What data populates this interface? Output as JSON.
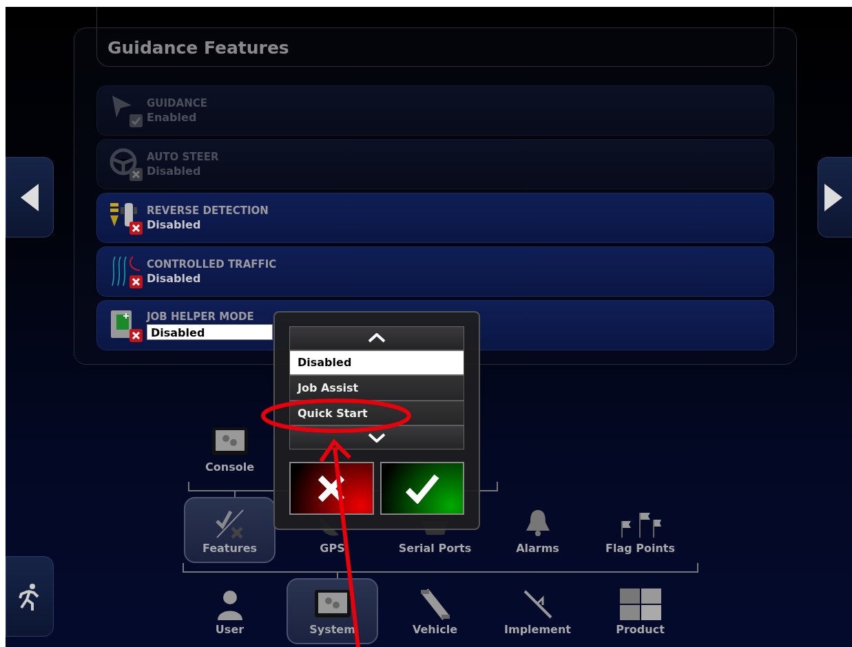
{
  "panel": {
    "title": "Guidance Features"
  },
  "features": [
    {
      "kind": "text",
      "title": "GUIDANCE",
      "value": "Enabled",
      "disabled": true,
      "on": true
    },
    {
      "kind": "text",
      "title": "AUTO STEER",
      "value": "Disabled",
      "disabled": true,
      "on": false
    },
    {
      "kind": "text",
      "title": "REVERSE DETECTION",
      "value": "Disabled",
      "disabled": false,
      "on": false
    },
    {
      "kind": "text",
      "title": "CONTROLLED TRAFFIC",
      "value": "Disabled",
      "disabled": false,
      "on": false
    },
    {
      "kind": "dropdown",
      "title": "JOB HELPER MODE",
      "value": "Disabled",
      "disabled": false,
      "on": false
    }
  ],
  "dropdown": {
    "options": [
      {
        "label": "Disabled",
        "selected": true
      },
      {
        "label": "Job Assist",
        "selected": false
      },
      {
        "label": "Quick Start",
        "selected": false
      }
    ]
  },
  "menu": [
    {
      "items": [
        {
          "label": "Console",
          "selected": false
        }
      ]
    },
    {
      "items": [
        {
          "label": "Features",
          "selected": true
        },
        {
          "label": "GPS",
          "selected": false
        },
        {
          "label": "Serial Ports",
          "selected": false
        },
        {
          "label": "Alarms",
          "selected": false
        },
        {
          "label": "Flag Points",
          "selected": false
        }
      ]
    },
    {
      "items": [
        {
          "label": "User",
          "selected": false
        },
        {
          "label": "System",
          "selected": true
        },
        {
          "label": "Vehicle",
          "selected": false
        },
        {
          "label": "Implement",
          "selected": false
        },
        {
          "label": "Product",
          "selected": false
        }
      ]
    }
  ]
}
